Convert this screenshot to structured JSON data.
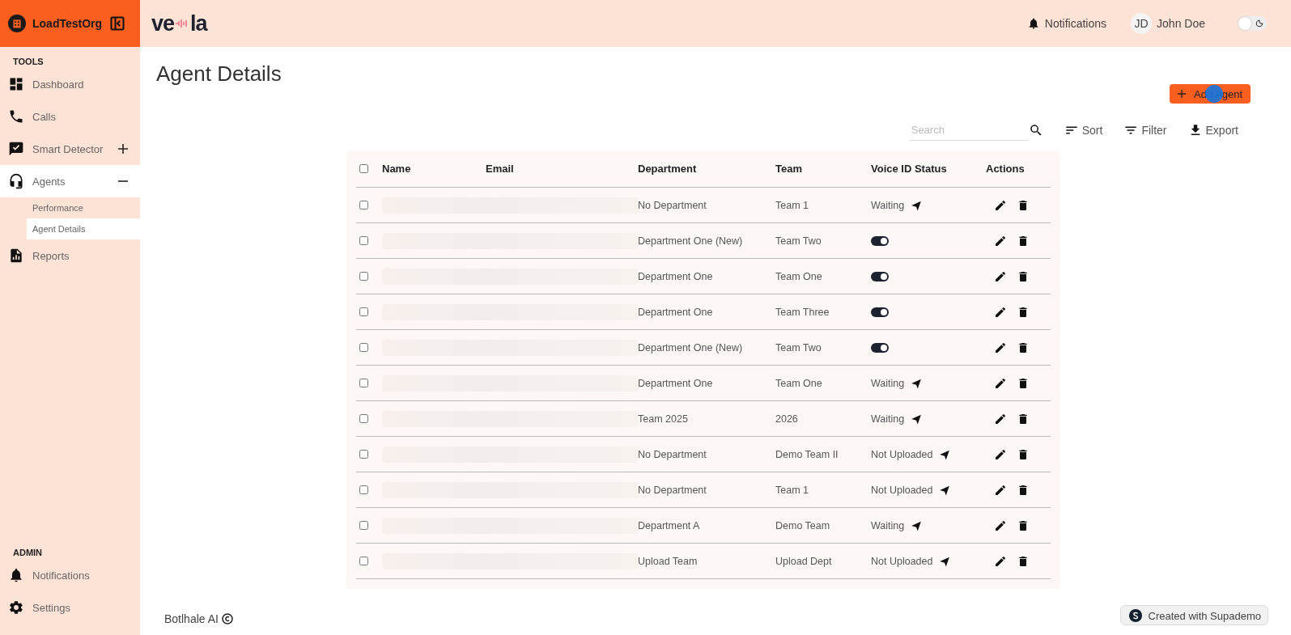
{
  "org": {
    "name": "LoadTestOrg"
  },
  "logo": {
    "left": "ve",
    "right": "la"
  },
  "header": {
    "notifications": "Notifications",
    "user": {
      "initials": "JD",
      "name": "John Doe"
    },
    "dark_mode": {
      "on": false
    }
  },
  "sidebar": {
    "sections": [
      {
        "title": "TOOLS",
        "items": [
          {
            "label": "Dashboard",
            "selected": false
          },
          {
            "label": "Calls",
            "selected": false
          },
          {
            "label": "Smart Detector",
            "selected": false,
            "expanded": false
          },
          {
            "label": "Agents",
            "selected": true,
            "expanded": true,
            "children": [
              {
                "label": "Performance",
                "selected": false
              },
              {
                "label": "Agent Details",
                "selected": true
              }
            ]
          },
          {
            "label": "Reports",
            "selected": false
          }
        ]
      },
      {
        "title": "ADMIN",
        "items": [
          {
            "label": "Notifications",
            "selected": false
          },
          {
            "label": "Settings",
            "selected": false
          }
        ]
      }
    ]
  },
  "page": {
    "title": "Agent Details",
    "add_button": "Add Agent",
    "search": {
      "placeholder": "Search"
    },
    "sort": "Sort",
    "filter": "Filter",
    "export": "Export"
  },
  "table": {
    "header_checked": false,
    "columns": [
      "Name",
      "Email",
      "Department",
      "Team",
      "Voice ID Status",
      "Actions"
    ],
    "rows": [
      {
        "checked": false,
        "department": "No Department",
        "team": "Team 1",
        "voice": {
          "kind": "status",
          "text": "Waiting"
        }
      },
      {
        "checked": false,
        "department": "Department One (New)",
        "team": "Team Two",
        "voice": {
          "kind": "toggle",
          "on": true
        }
      },
      {
        "checked": false,
        "department": "Department One",
        "team": "Team One",
        "voice": {
          "kind": "toggle",
          "on": true
        }
      },
      {
        "checked": false,
        "department": "Department One",
        "team": "Team Three",
        "voice": {
          "kind": "toggle",
          "on": true
        }
      },
      {
        "checked": false,
        "department": "Department One (New)",
        "team": "Team Two",
        "voice": {
          "kind": "toggle",
          "on": true
        }
      },
      {
        "checked": false,
        "department": "Department One",
        "team": "Team One",
        "voice": {
          "kind": "status",
          "text": "Waiting"
        }
      },
      {
        "checked": false,
        "department": "Team 2025",
        "team": "2026",
        "voice": {
          "kind": "status",
          "text": "Waiting"
        }
      },
      {
        "checked": false,
        "department": "No Department",
        "team": "Demo Team II",
        "voice": {
          "kind": "status",
          "text": "Not Uploaded"
        }
      },
      {
        "checked": false,
        "department": "No Department",
        "team": "Team 1",
        "voice": {
          "kind": "status",
          "text": "Not Uploaded"
        }
      },
      {
        "checked": false,
        "department": "Department A",
        "team": "Demo Team",
        "voice": {
          "kind": "status",
          "text": "Waiting"
        }
      },
      {
        "checked": false,
        "department": "Upload Team",
        "team": "Upload Dept",
        "voice": {
          "kind": "status",
          "text": "Not Uploaded"
        }
      }
    ]
  },
  "footer": {
    "company": "Botlhale AI"
  },
  "badge": {
    "text": "Created with Supademo"
  }
}
